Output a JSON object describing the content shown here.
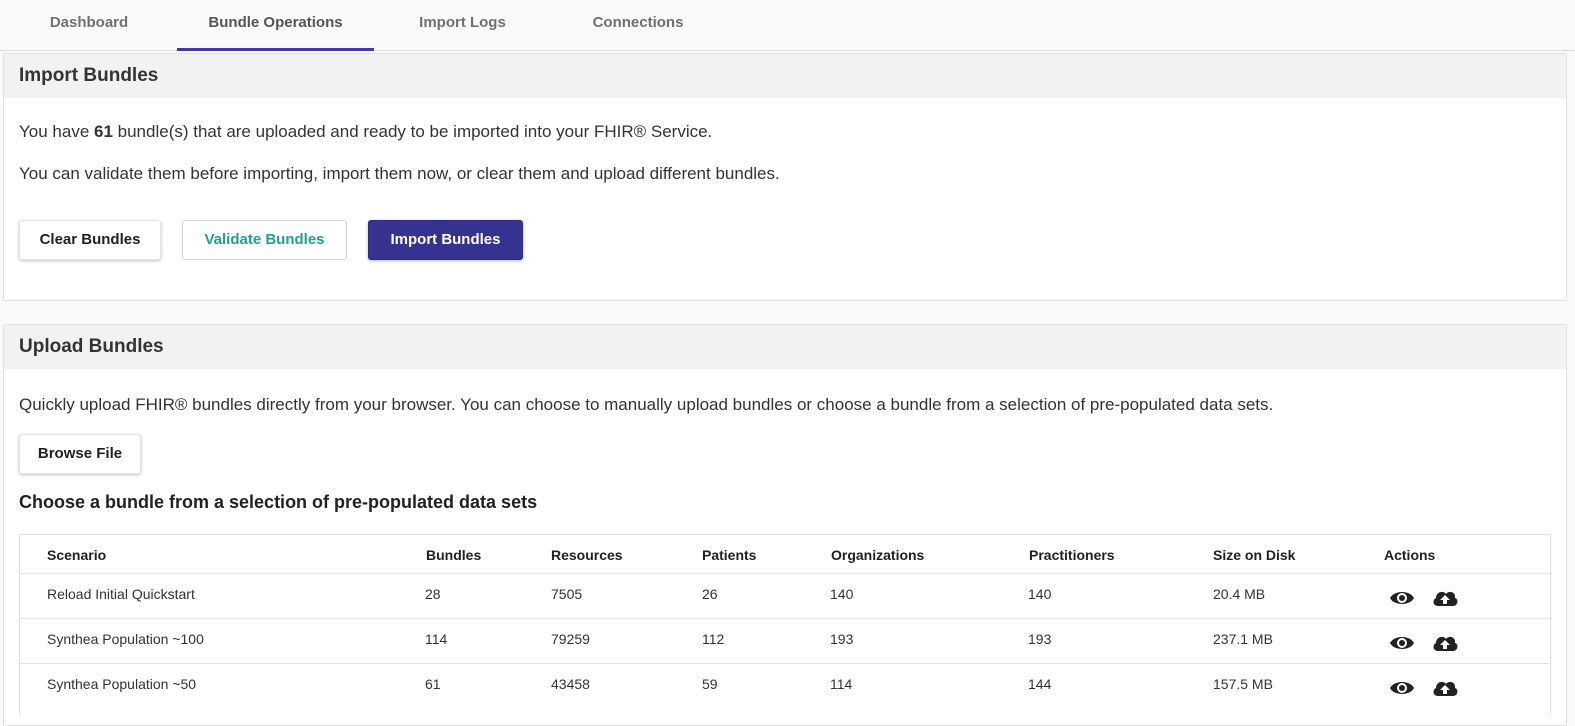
{
  "tabs": [
    {
      "label": "Dashboard",
      "active": false
    },
    {
      "label": "Bundle Operations",
      "active": true
    },
    {
      "label": "Import Logs",
      "active": false
    },
    {
      "label": "Connections",
      "active": false
    }
  ],
  "import_section": {
    "title": "Import Bundles",
    "line1_prefix": "You have ",
    "bundle_count": "61",
    "line1_suffix": " bundle(s) that are uploaded and ready to be imported into your FHIR® Service.",
    "line2": "You can validate them before importing, import them now, or clear them and upload different bundles.",
    "clear_label": "Clear Bundles",
    "validate_label": "Validate Bundles",
    "import_label": "Import Bundles"
  },
  "upload_section": {
    "title": "Upload Bundles",
    "description": "Quickly upload FHIR® bundles directly from your browser. You can choose to manually upload bundles or choose a bundle from a selection of pre-populated data sets.",
    "browse_label": "Browse File",
    "subheading": "Choose a bundle from a selection of pre-populated data sets"
  },
  "table": {
    "columns": [
      "Scenario",
      "Bundles",
      "Resources",
      "Patients",
      "Organizations",
      "Practitioners",
      "Size on Disk",
      "Actions"
    ],
    "rows": [
      [
        "Reload Initial Quickstart",
        "28",
        "7505",
        "26",
        "140",
        "140",
        "20.4 MB"
      ],
      [
        "Synthea Population ~100",
        "114",
        "79259",
        "112",
        "193",
        "193",
        "237.1 MB"
      ],
      [
        "Synthea Population ~50",
        "61",
        "43458",
        "59",
        "114",
        "144",
        "157.5 MB"
      ]
    ],
    "row_actions": [
      "eye-icon",
      "cloud-upload-icon"
    ]
  },
  "colors": {
    "tab_active_underline": "#3f3aa6",
    "primary_button": "#363292",
    "validate_text": "#1f9e9a",
    "header_background": "#f2f2f2"
  }
}
